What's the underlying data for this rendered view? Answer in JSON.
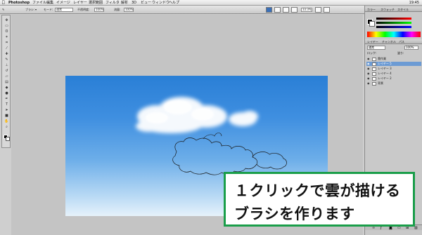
{
  "menubar": {
    "apple": "",
    "app": "Photoshop",
    "items": [
      "ファイル",
      "編集",
      "イメージ",
      "レイヤー",
      "選択範囲",
      "フィルタ",
      "解析",
      "3D",
      "ビュー",
      "ウィンドウ",
      "ヘルプ"
    ],
    "clock": "19:45"
  },
  "options": {
    "brush_label": "ブラシ:",
    "mode_label": "モード:",
    "mode_value": "通常",
    "opacity_label": "不透明度:",
    "opacity_value": "100%",
    "flow_label": "流量:",
    "flow_value": "100%",
    "zoom": "33.3%"
  },
  "panels": {
    "color_tabs": [
      "カラー",
      "スウォッチ",
      "スタイル"
    ],
    "layers_tabs": [
      "レイヤー",
      "チャンネル",
      "パス"
    ],
    "blend_mode": "通常",
    "opacity": "100%",
    "lock_label": "ロック:",
    "fill_label": "塗り:",
    "layers": [
      {
        "name": "雲作業",
        "selected": false
      },
      {
        "name": "レイヤー 5",
        "selected": true
      },
      {
        "name": "レイヤー 3",
        "selected": false
      },
      {
        "name": "レイヤー 4",
        "selected": false
      },
      {
        "name": "レイヤー 2",
        "selected": false
      },
      {
        "name": "背景",
        "selected": false
      }
    ]
  },
  "caption": {
    "line1": "１クリックで雲が描ける",
    "line2": "ブラシを作ります"
  },
  "colors": {
    "caption_border": "#1a9e4a",
    "sky_top": "#2a7fd6",
    "sky_bottom": "#e6f2fb",
    "selected_layer": "#6c9bd4"
  }
}
